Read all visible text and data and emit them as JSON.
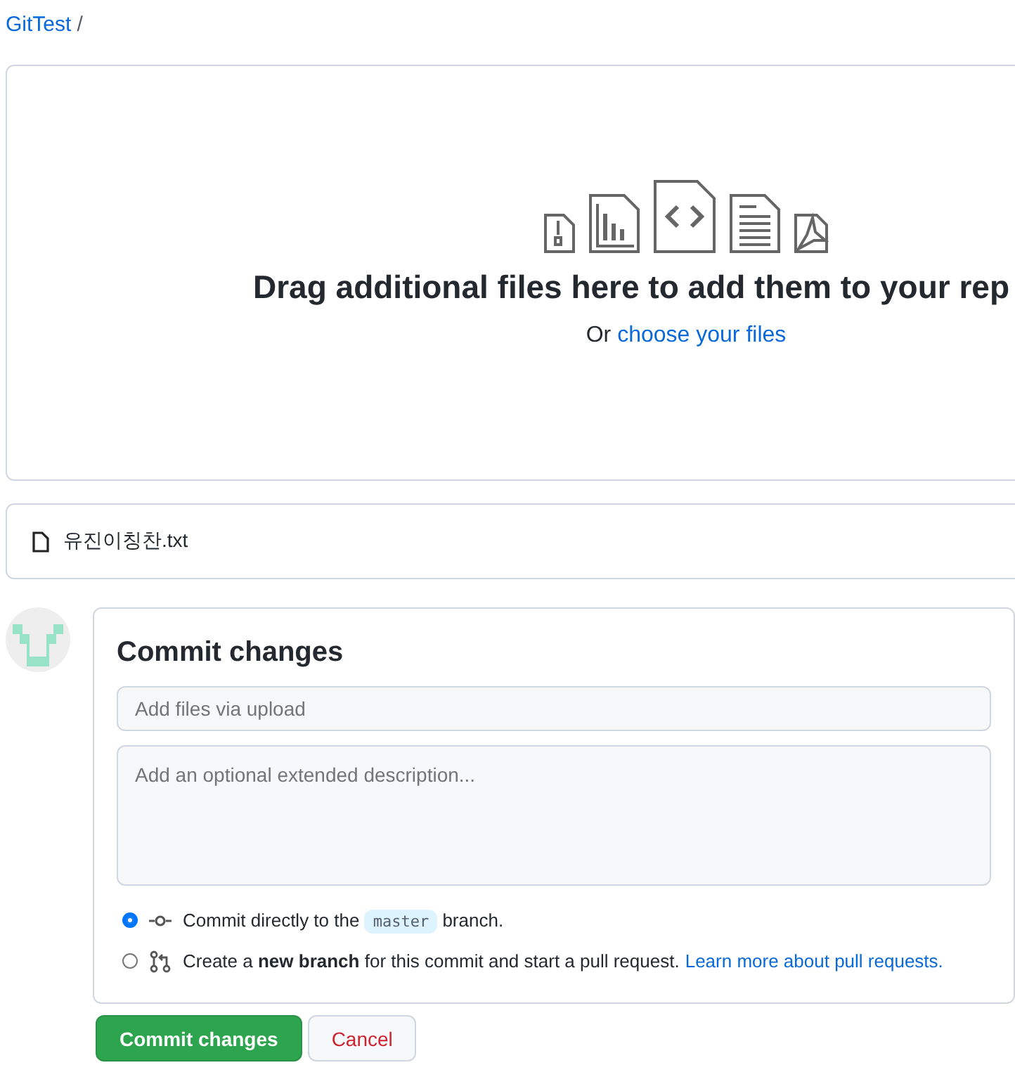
{
  "breadcrumb": {
    "repo": "GitTest",
    "separator": "/"
  },
  "dropzone": {
    "heading": "Drag additional files here to add them to your rep",
    "prompt": "Or",
    "link": "choose your files"
  },
  "files": [
    {
      "name": "유진이칭찬.txt"
    }
  ],
  "commit": {
    "title": "Commit changes",
    "summary": {
      "placeholder": "Add files via upload"
    },
    "description": {
      "placeholder": "Add an optional extended description..."
    },
    "options": [
      {
        "kind": "direct",
        "selected": true,
        "text": "Commit directly to the ",
        "branch": "master",
        "after": " branch."
      },
      {
        "kind": "new-branch",
        "selected": false,
        "text": "Create a **new branch** for this commit and start a pull request.",
        "link": "Learn more about pull requests."
      }
    ]
  },
  "buttons": [
    {
      "kind": "primary",
      "label": "Commit changes"
    },
    {
      "kind": "cancel",
      "label": "Cancel"
    }
  ]
}
